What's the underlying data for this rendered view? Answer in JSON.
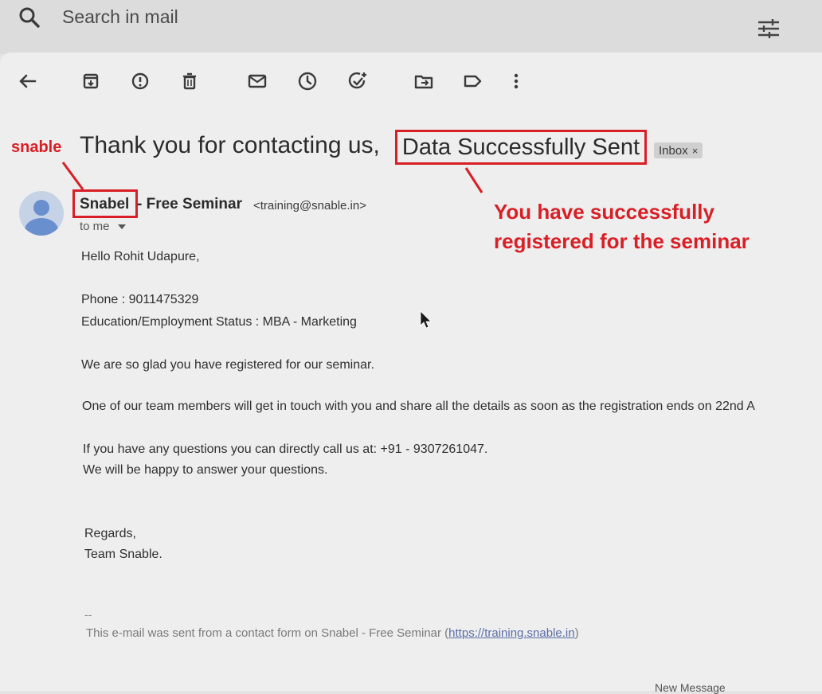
{
  "search": {
    "placeholder": "Search in mail"
  },
  "toolbar": {
    "buttons": [
      "back-arrow",
      "archive",
      "report-spam",
      "delete",
      "mark-unread",
      "snooze",
      "add-to-tasks",
      "move-to",
      "labels",
      "more-options"
    ]
  },
  "email": {
    "subject_prefix": "Thank you for contacting us,",
    "subject_highlight": "Data Successfully Sent",
    "label_chip": "Inbox",
    "label_chip_close": "×",
    "sender_name": "Snabel",
    "sender_rest": "- Free Seminar",
    "sender_email": "<training@snable.in>",
    "to_me": "to me",
    "body": [
      "Hello Rohit Udapure,",
      "Phone : 9011475329",
      "Education/Employment Status : MBA - Marketing",
      "We are so glad you have registered for our seminar.",
      "One of our team members will get in touch with you and share all the details as soon as the registration ends on 22nd A",
      "If you have any questions you can directly call us at: +91 - 9307261047.",
      "We will be happy to answer your questions.",
      "Regards,",
      "Team Snable."
    ],
    "signature_dash": "--",
    "footer_text": "This e-mail was sent from a contact form on Snabel - Free Seminar (",
    "footer_link": "https://training.snable.in",
    "footer_end": ")",
    "cut_off_text": "New Message"
  },
  "annotations": {
    "left_label": "snable",
    "right_label_line1": "You have successfully",
    "right_label_line2": "registered for the seminar"
  },
  "colors": {
    "annotation_red": "#d81f26",
    "avatar_blue": "#6a8fce",
    "link_blue": "#5a6fa8"
  }
}
